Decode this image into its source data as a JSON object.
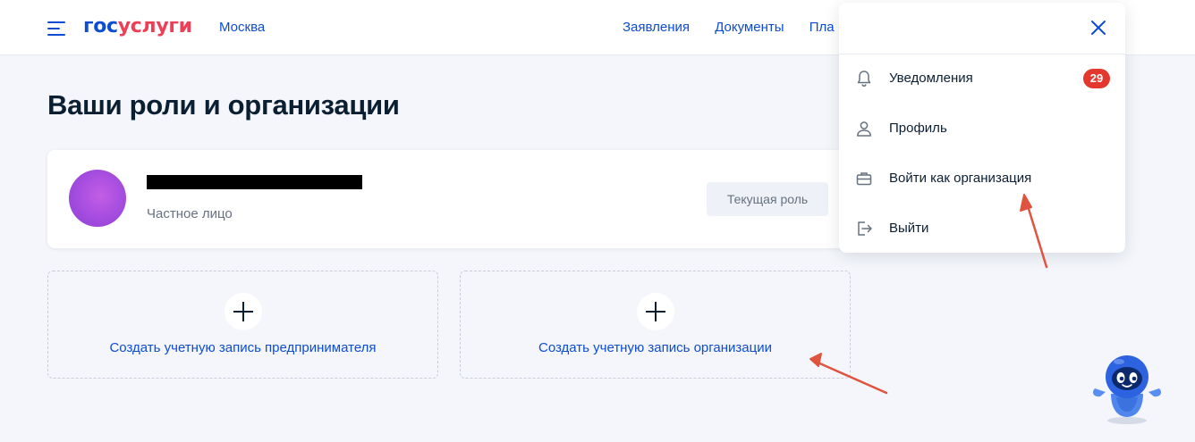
{
  "header": {
    "logo_part1": "гос",
    "logo_part2": "услуги",
    "city": "Москва",
    "nav": [
      "Заявления",
      "Документы",
      "Пла"
    ]
  },
  "page": {
    "title": "Ваши роли и организации"
  },
  "role_card": {
    "role_type": "Частное лицо",
    "current_role_label": "Текущая роль"
  },
  "tiles": [
    {
      "label": "Создать учетную запись предпринимателя"
    },
    {
      "label": "Создать учетную запись организации"
    }
  ],
  "menu": {
    "items": [
      {
        "label": "Уведомления",
        "icon": "bell-icon",
        "badge": "29"
      },
      {
        "label": "Профиль",
        "icon": "user-icon"
      },
      {
        "label": "Войти как организация",
        "icon": "briefcase-icon"
      },
      {
        "label": "Выйти",
        "icon": "logout-icon"
      }
    ]
  },
  "colors": {
    "brand_blue": "#0d4cd3",
    "brand_red": "#ee3f58",
    "badge_red": "#e2382d",
    "annotation_arrow": "#e0533f",
    "background": "#f4f6fb"
  }
}
